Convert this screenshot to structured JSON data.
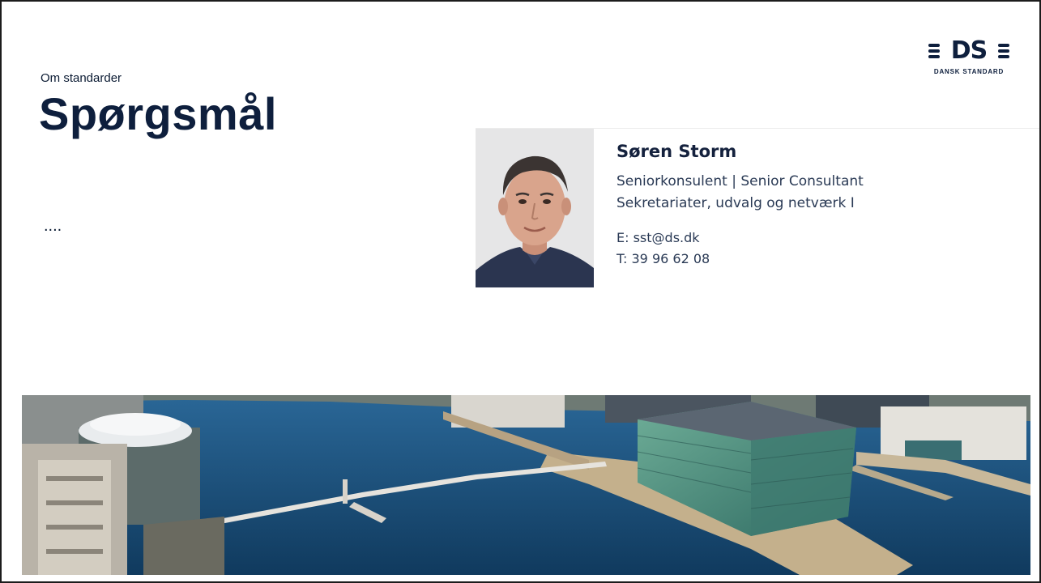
{
  "slide": {
    "subtitle": "Om standarder",
    "title": "Spørgsmål",
    "body_text": "...."
  },
  "logo": {
    "mark_text": "DS",
    "subtext": "DANSK STANDARD"
  },
  "contact_card": {
    "name": "Søren Storm",
    "role_line_1": "Seniorkonsulent | Senior Consultant",
    "role_line_2": "Sekretariater, udvalg og netværk I",
    "email": "E: sst@ds.dk",
    "phone": "T: 39 96 62 08"
  },
  "colors": {
    "brand_navy": "#0e1f3d",
    "water": "#1f4f7a",
    "building_glass": "#4f8f7a"
  },
  "images": {
    "portrait": "portrait-photo",
    "hero": "copenhagen-harbour-aerial-photo"
  }
}
